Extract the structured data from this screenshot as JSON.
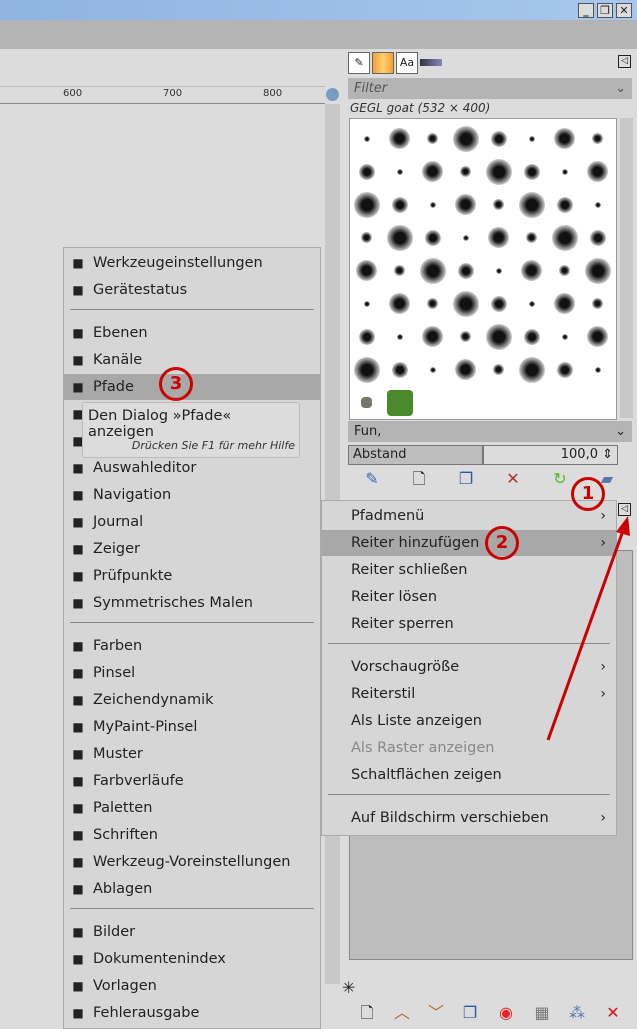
{
  "window": {
    "minimize": "_",
    "restore": "❐",
    "close": "✕"
  },
  "ruler": {
    "labels": [
      "600",
      "700",
      "800"
    ]
  },
  "dock": {
    "filter_placeholder": "Filter",
    "brush_title": "GEGL goat (532 × 400)",
    "tag_combo": "Fun,",
    "spacing_label": "Abstand",
    "spacing_value": "100,0"
  },
  "left_menu": {
    "items": [
      {
        "label": "Werkzeugeinstellungen",
        "icon": "tool-options-icon",
        "sep_after": false
      },
      {
        "label": "Gerätestatus",
        "icon": "device-status-icon",
        "sep_after": true
      },
      {
        "label": "Ebenen",
        "icon": "layers-icon"
      },
      {
        "label": "Kanäle",
        "icon": "channels-icon"
      },
      {
        "label": "Pfade",
        "icon": "paths-icon",
        "highlighted": true
      },
      {
        "label": "",
        "icon": "colormap-icon"
      },
      {
        "label": "",
        "icon": "histogram-icon"
      },
      {
        "label": "Auswahleditor",
        "icon": "selection-editor-icon"
      },
      {
        "label": "Navigation",
        "icon": "navigation-icon"
      },
      {
        "label": "Journal",
        "icon": "undo-history-icon"
      },
      {
        "label": "Zeiger",
        "icon": "pointer-icon"
      },
      {
        "label": "Prüfpunkte",
        "icon": "sample-points-icon"
      },
      {
        "label": "Symmetrisches Malen",
        "icon": "symmetry-icon",
        "sep_after": true
      },
      {
        "label": "Farben",
        "icon": "colors-icon"
      },
      {
        "label": "Pinsel",
        "icon": "brushes-icon"
      },
      {
        "label": "Zeichendynamik",
        "icon": "dynamics-icon"
      },
      {
        "label": "MyPaint-Pinsel",
        "icon": "mypaint-brushes-icon"
      },
      {
        "label": "Muster",
        "icon": "patterns-icon"
      },
      {
        "label": "Farbverläufe",
        "icon": "gradients-icon"
      },
      {
        "label": "Paletten",
        "icon": "palettes-icon"
      },
      {
        "label": "Schriften",
        "icon": "fonts-icon"
      },
      {
        "label": "Werkzeug-Voreinstellungen",
        "icon": "tool-presets-icon"
      },
      {
        "label": "Ablagen",
        "icon": "buffers-icon",
        "sep_after": true
      },
      {
        "label": "Bilder",
        "icon": "images-icon"
      },
      {
        "label": "Dokumentenindex",
        "icon": "document-history-icon"
      },
      {
        "label": "Vorlagen",
        "icon": "templates-icon"
      },
      {
        "label": "Fehlerausgabe",
        "icon": "error-console-icon"
      }
    ]
  },
  "tooltip": {
    "title": "Den Dialog »Pfade« anzeigen",
    "hint": "Drücken Sie F1 für mehr Hilfe"
  },
  "sub_menu": {
    "items": [
      {
        "label": "Pfadmenü",
        "submenu": true
      },
      {
        "label": "Reiter hinzufügen",
        "submenu": true,
        "highlighted": true
      },
      {
        "label": "Reiter schließen"
      },
      {
        "label": "Reiter lösen"
      },
      {
        "label": "Reiter sperren",
        "sep_after": true
      },
      {
        "label": "Vorschaugröße",
        "submenu": true
      },
      {
        "label": "Reiterstil",
        "submenu": true
      },
      {
        "label": "Als Liste anzeigen"
      },
      {
        "label": "Als Raster anzeigen",
        "disabled": true
      },
      {
        "label": "Schaltflächen zeigen",
        "sep_after": true
      },
      {
        "label": "Auf Bildschirm verschieben",
        "submenu": true
      }
    ]
  },
  "annotations": [
    "1",
    "2",
    "3"
  ],
  "colors": {
    "annotation": "#cc0000",
    "highlight": "#a8a8a8"
  }
}
